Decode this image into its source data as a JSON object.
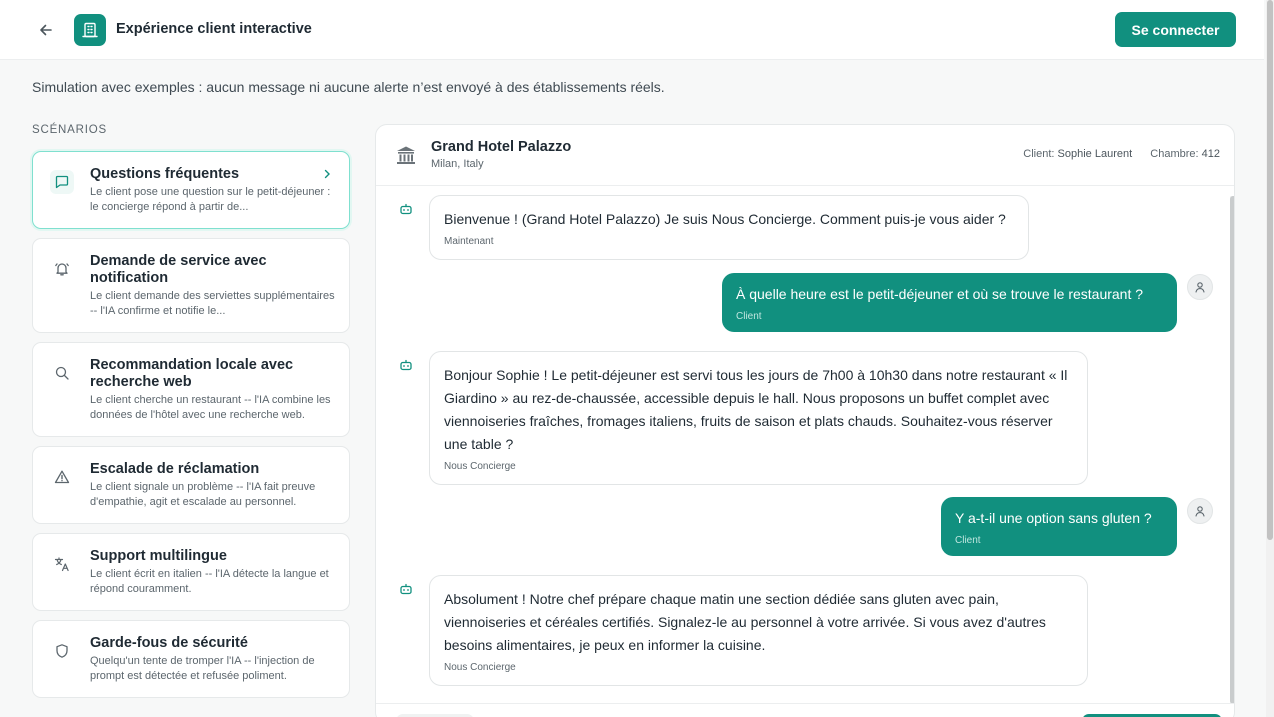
{
  "header": {
    "title": "Expérience client interactive",
    "login_label": "Se connecter",
    "brand_color": "#11907f"
  },
  "notice": "Simulation avec exemples : aucun message ni aucune alerte n’est envoyé à des établissements réels.",
  "sidebar": {
    "title": "SCÉNARIOS",
    "items": [
      {
        "icon": "message-square-icon",
        "title": "Questions fréquentes",
        "desc": "Le client pose une question sur le petit-déjeuner : le concierge répond à partir de...",
        "active": true
      },
      {
        "icon": "bell-ring-icon",
        "title": "Demande de service avec notification",
        "desc": "Le client demande des serviettes supplémentaires -- l'IA confirme et notifie le..."
      },
      {
        "icon": "search-icon",
        "title": "Recommandation locale avec recherche web",
        "desc": "Le client cherche un restaurant -- l'IA combine les données de l'hôtel avec une recherche web."
      },
      {
        "icon": "warning-triangle-icon",
        "title": "Escalade de réclamation",
        "desc": "Le client signale un problème -- l'IA fait preuve d'empathie, agit et escalade au personnel."
      },
      {
        "icon": "languages-icon",
        "title": "Support multilingue",
        "desc": "Le client écrit en italien -- l'IA détecte la langue et répond couramment."
      },
      {
        "icon": "shield-icon",
        "title": "Garde-fous de sécurité",
        "desc": "Quelqu'un tente de tromper l'IA -- l'injection de prompt est détectée et refusée poliment."
      }
    ]
  },
  "chat": {
    "hotel_name": "Grand Hotel Palazzo",
    "hotel_city": "Milan, Italy",
    "client_label": "Client:",
    "client_name": "Sophie Laurent",
    "room_label": "Chambre:",
    "room_number": "412",
    "messages": [
      {
        "role": "bot",
        "text": "Bienvenue ! (Grand Hotel Palazzo) Je suis Nous Concierge. Comment puis-je vous aider ?",
        "who": "Maintenant"
      },
      {
        "role": "user",
        "text": "À quelle heure est le petit-déjeuner et où se trouve le restaurant ?",
        "who": "Client"
      },
      {
        "role": "bot",
        "text": "Bonjour Sophie ! Le petit-déjeuner est servi tous les jours de 7h00 à 10h30 dans notre restaurant « Il Giardino » au rez-de-chaussée, accessible depuis le hall. Nous proposons un buffet complet avec viennoiseries fraîches, fromages italiens, fruits de saison et plats chauds. Souhaitez-vous réserver une table ?",
        "who": "Nous Concierge"
      },
      {
        "role": "user",
        "text": "Y a-t-il une option sans gluten ?",
        "who": "Client"
      },
      {
        "role": "bot",
        "text": "Absolument ! Notre chef prépare chaque matin une section dédiée sans gluten avec pain, viennoiseries et céréales certifiés. Signalez-le au personnel à votre arrivée. Si vous avez d'autres besoins alimentaires, je peux en informer la cuisine.",
        "who": "Nous Concierge"
      }
    ]
  }
}
